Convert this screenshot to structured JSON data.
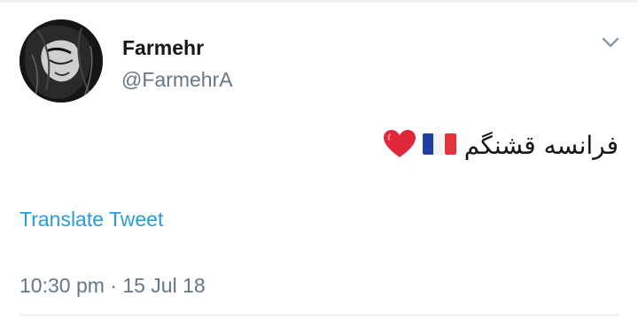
{
  "author": {
    "display_name": "Farmehr",
    "handle": "@FarmehrA"
  },
  "tweet": {
    "text": "فرانسه قشنگم",
    "emoji": [
      "french-flag",
      "red-heart"
    ]
  },
  "actions": {
    "translate_label": "Translate Tweet"
  },
  "meta": {
    "timestamp": "10:30 pm · 15 Jul 18"
  },
  "colors": {
    "link": "#2a9bd8",
    "secondary_text": "#657786",
    "primary_text": "#14171a",
    "heart": "#e0283a",
    "flag_blue": "#1f3fa6",
    "flag_red": "#e3323c"
  }
}
